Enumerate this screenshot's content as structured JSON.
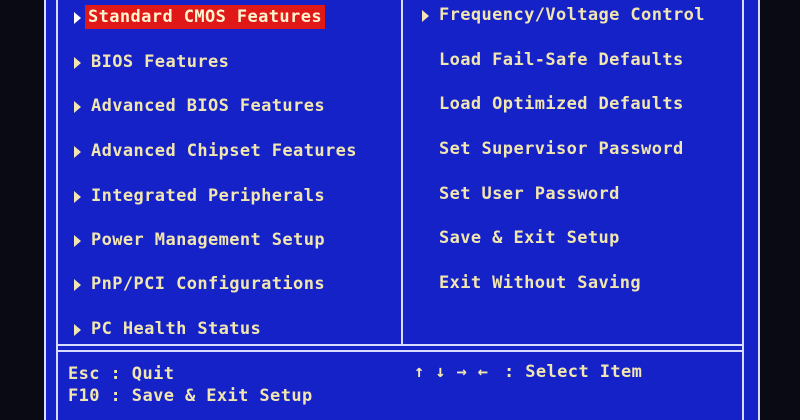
{
  "left_menu": [
    {
      "label": "Standard CMOS Features",
      "submenu": true,
      "selected": true
    },
    {
      "label": "BIOS Features",
      "submenu": true,
      "selected": false
    },
    {
      "label": "Advanced BIOS Features",
      "submenu": true,
      "selected": false
    },
    {
      "label": "Advanced Chipset Features",
      "submenu": true,
      "selected": false
    },
    {
      "label": "Integrated Peripherals",
      "submenu": true,
      "selected": false
    },
    {
      "label": "Power Management Setup",
      "submenu": true,
      "selected": false
    },
    {
      "label": "PnP/PCI Configurations",
      "submenu": true,
      "selected": false
    },
    {
      "label": "PC Health Status",
      "submenu": true,
      "selected": false
    }
  ],
  "right_menu": [
    {
      "label": "Frequency/Voltage Control",
      "submenu": true
    },
    {
      "label": "Load Fail-Safe Defaults",
      "submenu": false
    },
    {
      "label": "Load Optimized Defaults",
      "submenu": false
    },
    {
      "label": "Set Supervisor Password",
      "submenu": false
    },
    {
      "label": "Set User Password",
      "submenu": false
    },
    {
      "label": "Save & Exit Setup",
      "submenu": false
    },
    {
      "label": "Exit Without Saving",
      "submenu": false
    }
  ],
  "footer": {
    "esc_hint": "Esc : Quit",
    "f10_hint": "F10 : Save & Exit Setup",
    "arrow_keys": "↑ ↓ → ←",
    "select_hint": ": Select Item"
  },
  "colors": {
    "background": "#1422c8",
    "text": "#f2e6b0",
    "highlight": "#e01818",
    "border": "#d8dcff"
  }
}
